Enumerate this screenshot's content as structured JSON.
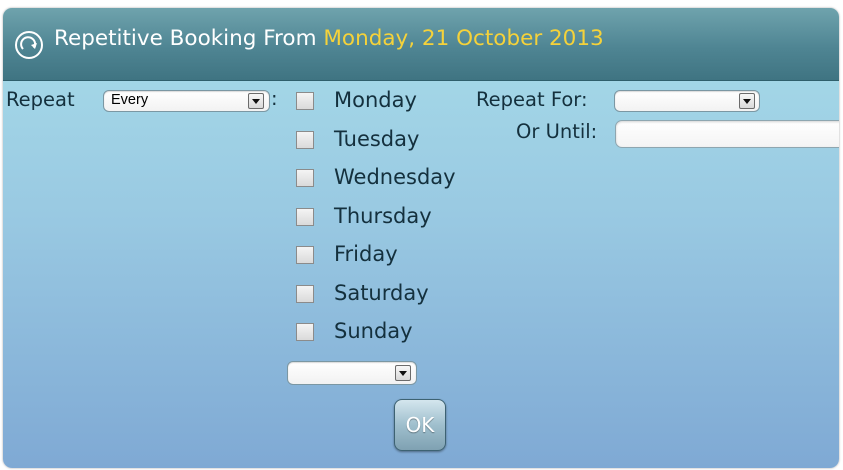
{
  "dialog": {
    "title_prefix": "Repetitive Booking From",
    "title_date": "Monday, 21 October 2013",
    "title_icon": "repeat-circle-icon",
    "colors": {
      "title_date": "#f5d23a",
      "title_bar": "#4f8593",
      "body": "#99c9e2"
    }
  },
  "repeat": {
    "label": "Repeat",
    "selected": "Every",
    "colon": ":"
  },
  "days": [
    {
      "label": "Monday",
      "checked": false
    },
    {
      "label": "Tuesday",
      "checked": false
    },
    {
      "label": "Wednesday",
      "checked": false
    },
    {
      "label": "Thursday",
      "checked": false
    },
    {
      "label": "Friday",
      "checked": false
    },
    {
      "label": "Saturday",
      "checked": false
    },
    {
      "label": "Sunday",
      "checked": false
    }
  ],
  "week_select": {
    "selected": ""
  },
  "repeat_for": {
    "label": "Repeat For:",
    "selected": ""
  },
  "or_until": {
    "label": "Or Until:",
    "value": ""
  },
  "ok_label": "OK"
}
